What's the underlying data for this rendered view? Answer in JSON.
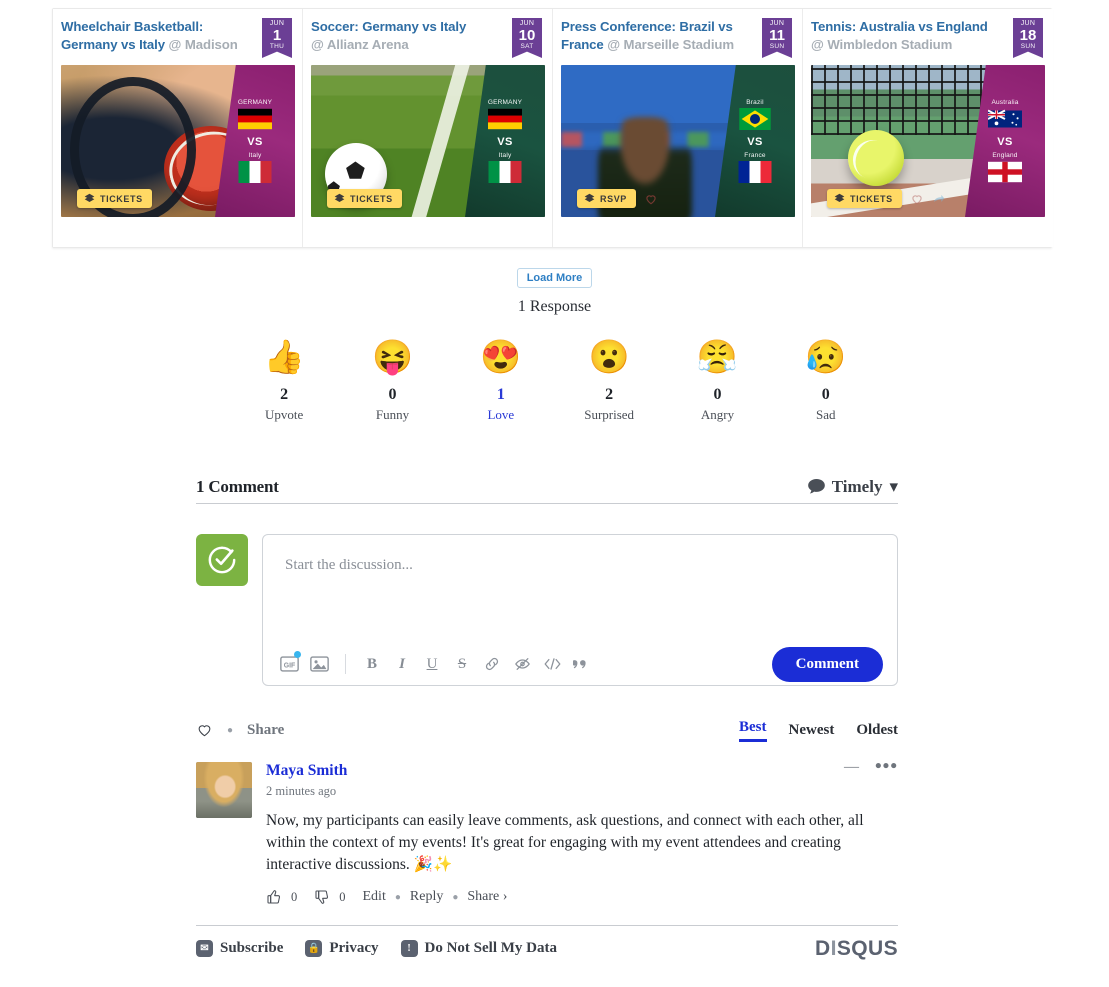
{
  "events": {
    "load_more_label": "Load More",
    "cards": [
      {
        "title": "Wheelchair Basketball: Germany vs Italy",
        "venue": "@ Madison",
        "date": {
          "month": "JUN",
          "day": "1",
          "weekday": "THU"
        },
        "team_a": "GERMANY",
        "team_b": "Italy",
        "vs_label": "VS",
        "action_label": "TICKETS",
        "overlay_color": "#8b2070",
        "has_heart": false,
        "has_share": false
      },
      {
        "title": "Soccer: Germany vs Italy",
        "venue": "@ Allianz Arena",
        "date": {
          "month": "JUN",
          "day": "10",
          "weekday": "SAT"
        },
        "team_a": "GERMANY",
        "team_b": "Italy",
        "vs_label": "VS",
        "action_label": "TICKETS",
        "overlay_color": "#1d4f3d",
        "has_heart": false,
        "has_share": false
      },
      {
        "title": "Press Conference: Brazil vs France",
        "venue": "@ Marseille Stadium",
        "date": {
          "month": "JUN",
          "day": "11",
          "weekday": "SUN"
        },
        "team_a": "Brazil",
        "team_b": "France",
        "vs_label": "VS",
        "action_label": "RSVP",
        "overlay_color": "#1d4f3d",
        "has_heart": true,
        "has_share": false
      },
      {
        "title": "Tennis: Australia vs England",
        "venue": "@ Wimbledon Stadium",
        "date": {
          "month": "JUN",
          "day": "18",
          "weekday": "SUN"
        },
        "team_a": "Australia",
        "team_b": "England",
        "vs_label": "VS",
        "action_label": "TICKETS",
        "overlay_color": "#8b2070",
        "has_heart": true,
        "has_share": true
      }
    ]
  },
  "responses": {
    "count_label": "1 Response",
    "reactions": [
      {
        "emoji": "👍",
        "count": "2",
        "label": "Upvote",
        "active": false
      },
      {
        "emoji": "😝",
        "count": "0",
        "label": "Funny",
        "active": false
      },
      {
        "emoji": "😍",
        "count": "1",
        "label": "Love",
        "active": true
      },
      {
        "emoji": "😮",
        "count": "2",
        "label": "Surprised",
        "active": false
      },
      {
        "emoji": "😤",
        "count": "0",
        "label": "Angry",
        "active": false
      },
      {
        "emoji": "😥",
        "count": "0",
        "label": "Sad",
        "active": false
      }
    ]
  },
  "comments": {
    "header_count": "1 Comment",
    "sort_dropdown_label": "Timely",
    "sort_dropdown_caret": "▾",
    "editor": {
      "placeholder": "Start the discussion...",
      "submit_label": "Comment",
      "toolbar": {
        "gif_label": "GIF",
        "bold_label": "B",
        "italic_label": "I",
        "underline_label": "U",
        "strike_label": "S",
        "quote_label": "“"
      }
    },
    "subbar": {
      "share_label": "Share",
      "sort_options": [
        {
          "label": "Best",
          "active": true
        },
        {
          "label": "Newest",
          "active": false
        },
        {
          "label": "Oldest",
          "active": false
        }
      ]
    },
    "list": [
      {
        "author": "Maya Smith",
        "time": "2 minutes ago",
        "text": "Now, my participants can easily leave comments, ask questions, and connect with each other, all within the context of my events! It's great for engaging with my event attendees and creating interactive discussions. 🎉✨",
        "upvotes": "0",
        "downvotes": "0",
        "edit_label": "Edit",
        "reply_label": "Reply",
        "share_label": "Share ›"
      }
    ]
  },
  "footer": {
    "subscribe_label": "Subscribe",
    "privacy_label": "Privacy",
    "do_not_sell_label": "Do Not Sell My Data",
    "brand": "DISQUS",
    "brand_part_1": "D",
    "brand_bar": "I",
    "brand_part_2": "SQUS"
  },
  "colors": {
    "link_blue": "#2e6da4",
    "accent_blue": "#1b2dd6",
    "badge_purple": "#6b3f95",
    "ticket_yellow": "#ffd964",
    "avatar_green": "#7cb342"
  }
}
